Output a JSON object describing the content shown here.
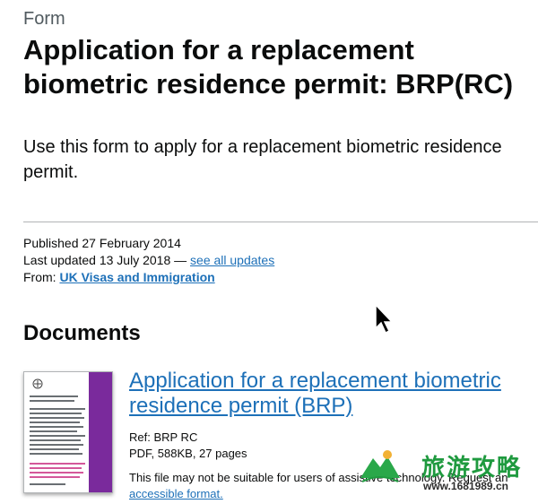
{
  "header": {
    "caption": "Form",
    "title": "Application for a replacement biometric residence permit: BRP(RC)"
  },
  "lede": "Use this form to apply for a replacement biometric residence permit.",
  "metadata": {
    "published": "Published 27 February 2014",
    "last_updated": "Last updated 13 July 2018 — ",
    "see_all_updates": "see all updates",
    "from_label": "From: ",
    "organisation": "UK Visas and Immigration"
  },
  "documents": {
    "heading": "Documents",
    "items": [
      {
        "title": "Application for a replacement biometric residence permit (BRP)",
        "ref": "Ref: BRP RC",
        "file_info": "PDF, 588KB, 27 pages",
        "accessibility_note": "This file may not be suitable for users of assistive technology. Request an",
        "accessible_format_link": "accessible format."
      }
    ]
  },
  "watermark": {
    "text": "旅游攻略",
    "url": "www.1681989.cn"
  },
  "colors": {
    "link": "#1d70b8",
    "text": "#0b0c0c",
    "secondary_text": "#505a5f",
    "border": "#b1b4b6",
    "thumbnail_band": "#7a2a9c",
    "watermark": "#1f9a3f"
  }
}
